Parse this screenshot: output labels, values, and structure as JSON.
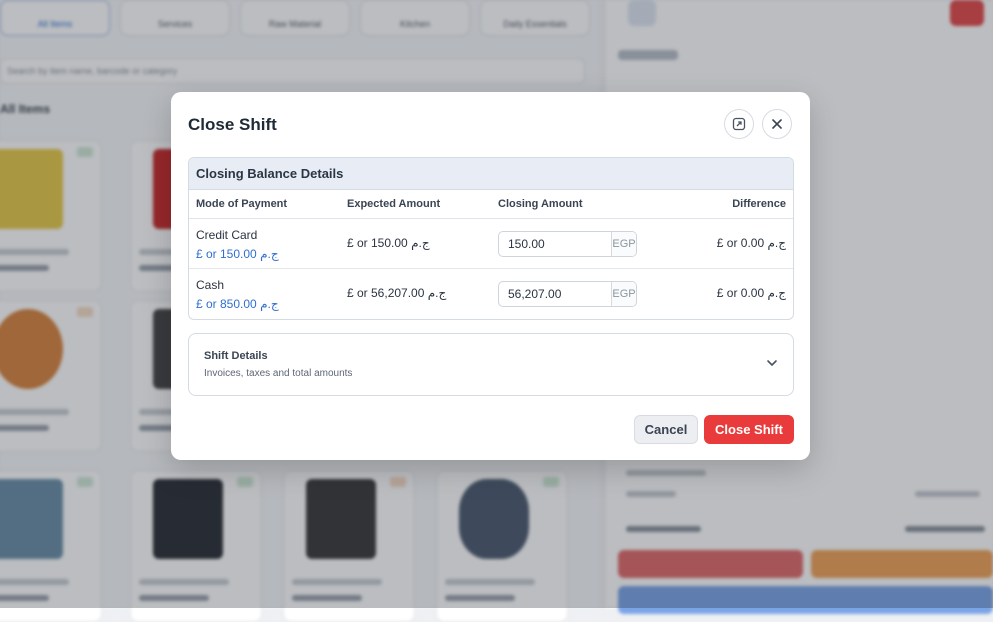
{
  "background": {
    "tabs": [
      "All Items",
      "Services",
      "Raw Material",
      "Kitchen",
      "Daily Essentials"
    ],
    "search_placeholder": "Search by item name, barcode or category",
    "section_title": "All Items"
  },
  "modal": {
    "title": "Close Shift",
    "expand_icon": "expand-icon",
    "close_icon": "close-icon",
    "table": {
      "title": "Closing Balance Details",
      "headers": {
        "mode": "Mode of Payment",
        "expected": "Expected Amount",
        "closing": "Closing Amount",
        "difference": "Difference"
      },
      "rows": [
        {
          "mode": "Credit Card",
          "mode_amount": "£ or 150.00 ج.م",
          "expected": "£ or 150.00 ج.م",
          "closing_value": "150.00",
          "currency": "EGP",
          "difference": "£ or 0.00 ج.م"
        },
        {
          "mode": "Cash",
          "mode_amount": "£ or 850.00 ج.م",
          "expected": "£ or 56,207.00 ج.م",
          "closing_value": "56,207.00",
          "currency": "EGP",
          "difference": "£ or 0.00 ج.م"
        }
      ]
    },
    "details": {
      "title": "Shift Details",
      "subtitle": "Invoices, taxes and total amounts"
    },
    "buttons": {
      "cancel": "Cancel",
      "close_shift": "Close Shift"
    }
  },
  "colors": {
    "primary_red": "#e93b3b",
    "link_blue": "#2f6fd0"
  }
}
